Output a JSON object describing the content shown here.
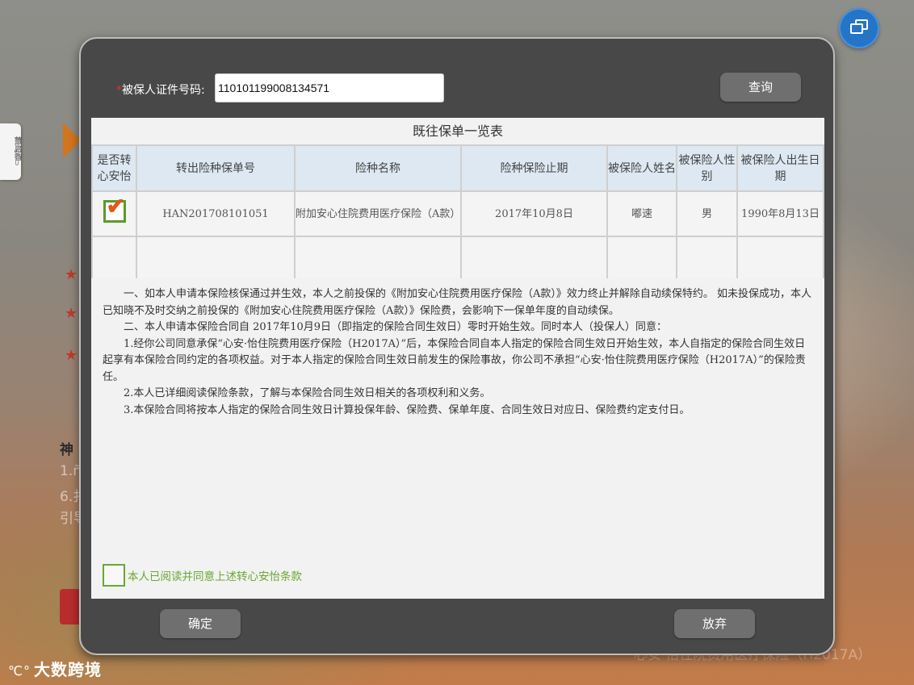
{
  "background": {
    "side_tab_label": "薑启香",
    "bold_heading": "神",
    "lines": [
      "1.ñ",
      "6.扌",
      "引导"
    ],
    "footer_text": "心安·怡住院费用医疗保险（H2017A）",
    "brand": "大数跨境",
    "brand_mark": "℃°"
  },
  "modal": {
    "id_label": "被保人证件号码:",
    "id_required_mark": "*",
    "id_value": "110101199008134571",
    "query_button": "查询",
    "table_title": "既往保单一览表",
    "columns": [
      "是否转心安怡",
      "转出险种保单号",
      "险种名称",
      "险种保险止期",
      "被保险人姓名",
      "被保险人性别",
      "被保险人出生日期"
    ],
    "rows": [
      {
        "checked": true,
        "policy_no": "HAN201708101051",
        "product": "附加安心住院费用医疗保险（A款）",
        "end_date": "2017年10月8日",
        "name": "嘟速",
        "gender": "男",
        "birth": "1990年8月13日"
      }
    ],
    "terms": [
      "一、如本人申请本保险核保通过并生效，本人之前投保的《附加安心住院费用医疗保险（A款）》效力终止并解除自动续保特约。 如未投保成功，本人已知晓不及时交纳之前投保的《附加安心住院费用医疗保险（A款）》保险费，会影响下一保单年度的自动续保。",
      "二、本人申请本保险合同自 2017年10月9日（即指定的保险合同生效日）零时开始生效。同时本人（投保人）同意：",
      "1.经你公司同意承保“心安·怡住院费用医疗保险（H2017A）”后，本保险合同自本人指定的保险合同生效日开始生效，本人自指定的保险合同生效日起享有本保险合同约定的各项权益。对于本人指定的保险合同生效日前发生的保险事故，你公司不承担“心安·怡住院费用医疗保险（H2017A）”的保险责任。",
      "2.本人已详细阅读保险条款，了解与本保险合同生效日相关的各项权利和义务。",
      "3.本保险合同将按本人指定的保险合同生效日计算投保年龄、保险费、保单年度、合同生效日对应日、保险费约定支付日。"
    ],
    "agree_label": "本人已阅读并同意上述转心安怡条款",
    "agree_checked": false,
    "confirm_button": "确定",
    "abandon_button": "放弃"
  },
  "colors": {
    "modal_bg": "#484848",
    "header_bg": "#dde8f2",
    "agree_green": "#6aa832",
    "accent_blue": "#2475c8",
    "required_red": "#e53030"
  },
  "icons": [
    "window-restore-icon",
    "checkmark-icon",
    "star-icon"
  ]
}
